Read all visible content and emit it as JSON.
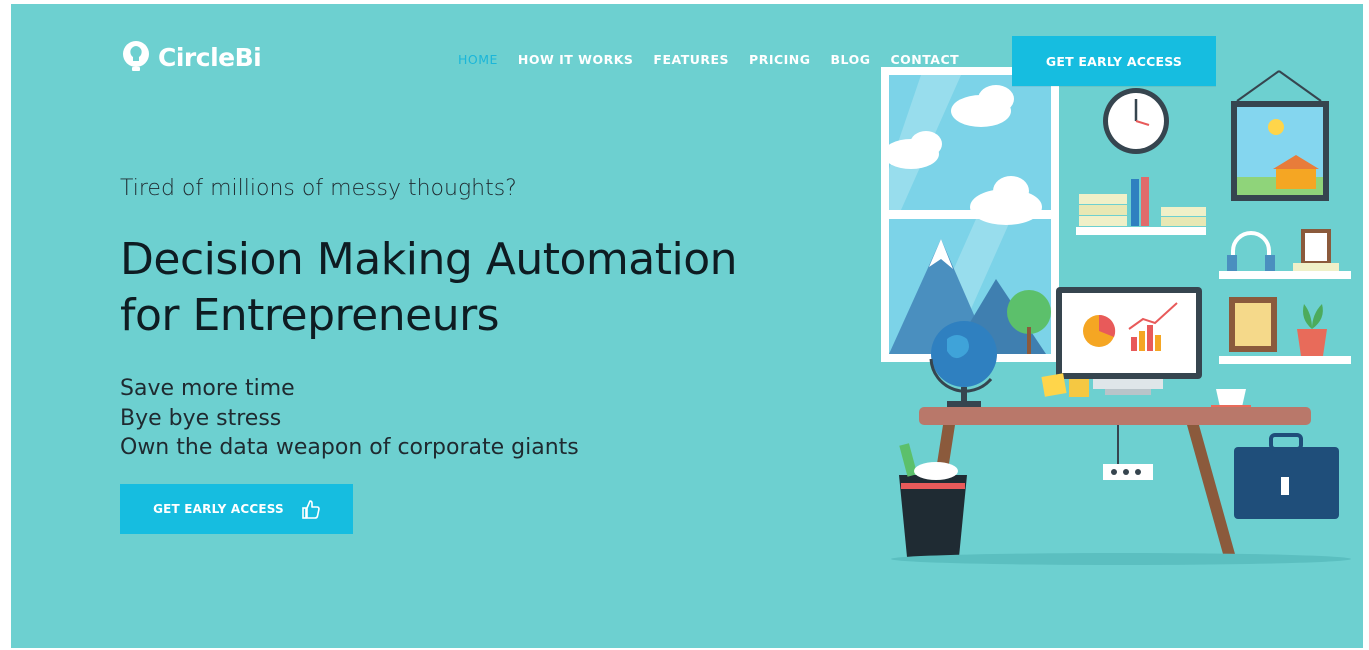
{
  "brand": {
    "name": "CircleBi",
    "icon": "lightbulb-icon"
  },
  "nav": {
    "items": [
      {
        "label": "HOME",
        "active": true
      },
      {
        "label": "HOW IT WORKS",
        "active": false
      },
      {
        "label": "FEATURES",
        "active": false
      },
      {
        "label": "PRICING",
        "active": false
      },
      {
        "label": "BLOG",
        "active": false
      },
      {
        "label": "CONTACT",
        "active": false
      }
    ],
    "cta_label": "GET EARLY ACCESS"
  },
  "hero": {
    "tagline": "Tired of millions of messy thoughts?",
    "headline_line1": "Decision Making Automation",
    "headline_line2": "for Entrepreneurs",
    "benefits": [
      "Save more time",
      "Bye bye stress",
      "Own the data weapon of corporate giants"
    ],
    "cta_label": "GET EARLY ACCESS",
    "cta_icon": "thumbs-up-icon"
  },
  "colors": {
    "background": "#6dd0d0",
    "accent": "#16bde0",
    "active_nav": "#1bb6d9",
    "text_dark": "#0e1c22"
  }
}
